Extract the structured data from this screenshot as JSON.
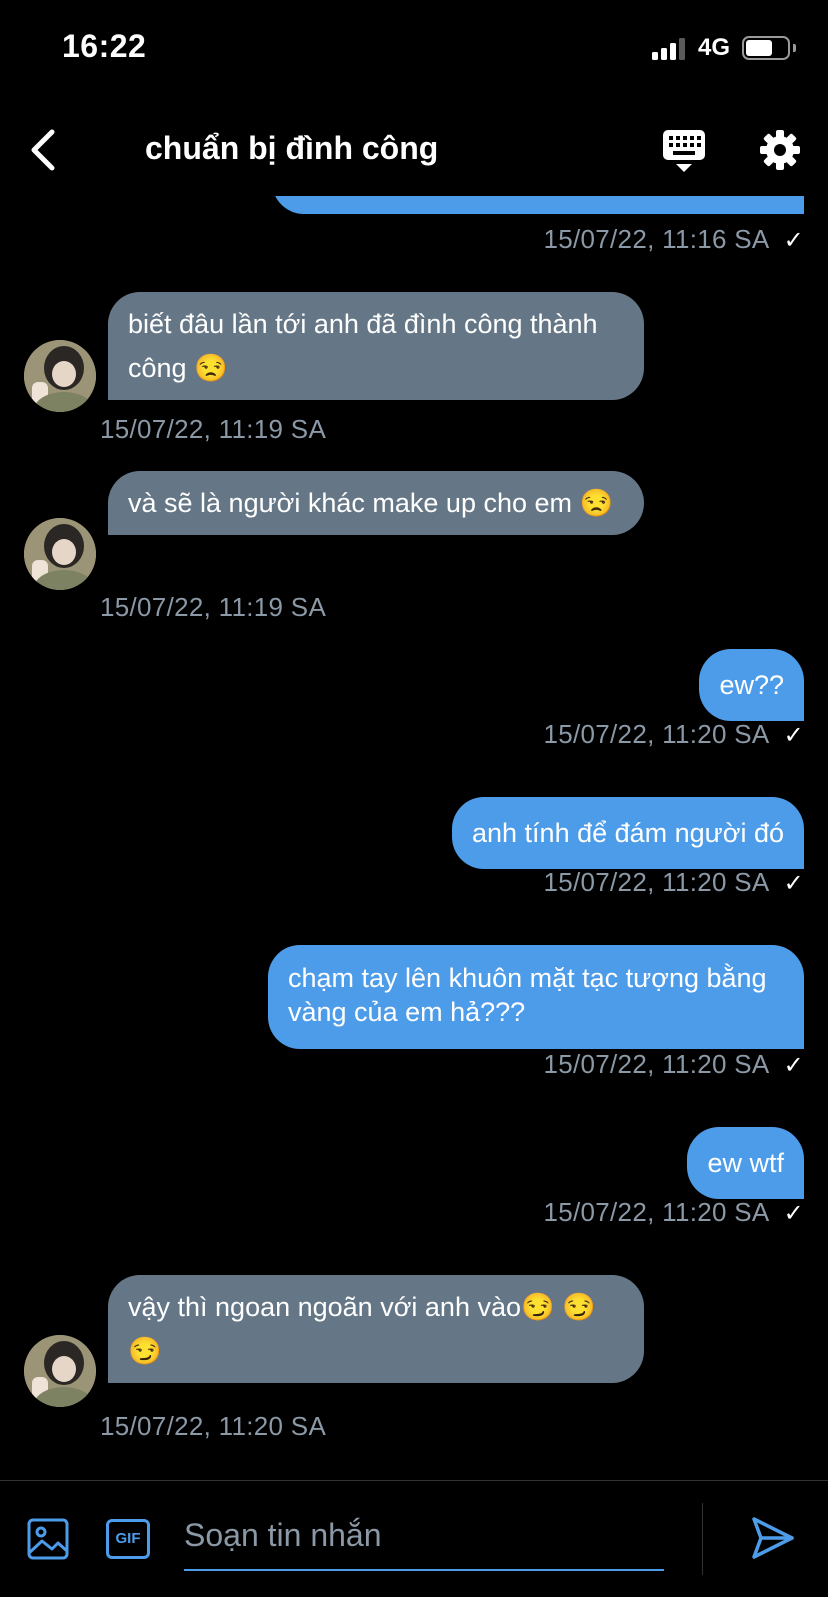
{
  "status_bar": {
    "time": "16:22",
    "network": "4G"
  },
  "header": {
    "title": "chuẩn bị đình công"
  },
  "messages": [
    {
      "text": "",
      "time": "15/07/22, 11:16 SA",
      "check": "✓"
    },
    {
      "text": " biết đâu lần tới anh đã đình công thành công 😒",
      "time": "15/07/22, 11:19 SA"
    },
    {
      "text": "và sẽ là người khác make up cho em 😒",
      "time": "15/07/22, 11:19 SA"
    },
    {
      "text": "ew??",
      "time": "15/07/22, 11:20 SA",
      "check": "✓"
    },
    {
      "text": "anh tính để đám người đó",
      "time": "15/07/22, 11:20 SA",
      "check": "✓"
    },
    {
      "text": "chạm tay lên khuôn mặt tạc tượng bằng vàng của em hả???",
      "time": "15/07/22, 11:20 SA",
      "check": "✓"
    },
    {
      "text": "ew wtf",
      "time": "15/07/22, 11:20 SA",
      "check": "✓"
    },
    {
      "text": "vậy thì ngoan ngoãn với anh vào😏 😏 😏",
      "time": "15/07/22, 11:20 SA"
    }
  ],
  "composer": {
    "placeholder": "Soạn tin nhắn",
    "gif_label": "GIF"
  },
  "colors": {
    "outgoing": "#4d9ce9",
    "incoming": "#657786",
    "timestamp": "#8b98a5"
  }
}
